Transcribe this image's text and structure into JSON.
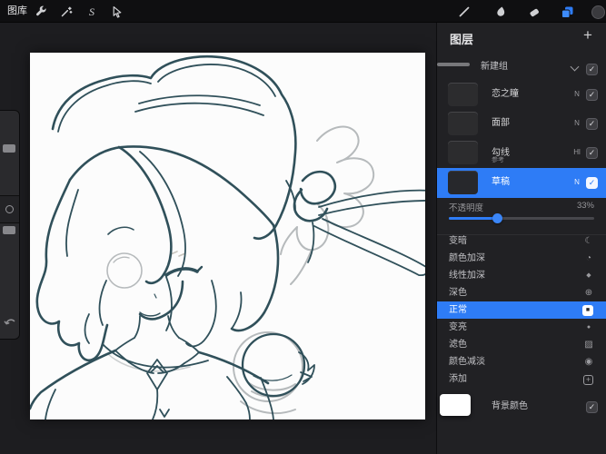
{
  "topbar": {
    "gallery_label": "图库",
    "left_tools": [
      "actions-wrench",
      "adjustments-wand",
      "selection-s",
      "transform-arrow"
    ],
    "selection_glyph": "S",
    "right_tools": [
      "brush",
      "smudge",
      "eraser",
      "layers",
      "color"
    ]
  },
  "layers_panel": {
    "title": "图层",
    "add_label": "+",
    "group": {
      "label": "新建组"
    },
    "layers": [
      {
        "name": "恋之瞳",
        "badge": "N",
        "checked": true,
        "selected": false
      },
      {
        "name": "面部",
        "badge": "N",
        "checked": true,
        "selected": false
      },
      {
        "name": "勾线",
        "sub": "参考",
        "badge": "Hl",
        "checked": true,
        "selected": false
      },
      {
        "name": "草稿",
        "badge": "N",
        "checked": true,
        "selected": true
      }
    ],
    "opacity": {
      "label": "不透明度",
      "value": "33%",
      "percent": 33
    },
    "blend_modes": [
      {
        "label": "变暗",
        "icon": "darken-moon-icon",
        "glyph": "☾",
        "selected": false
      },
      {
        "label": "颜色加深",
        "icon": "color-burn-icon",
        "glyph": "◔",
        "selected": false
      },
      {
        "label": "线性加深",
        "icon": "linear-burn-icon",
        "glyph": "◆",
        "selected": false
      },
      {
        "label": "深色",
        "icon": "darker-color-icon",
        "glyph": "⊕",
        "selected": false
      },
      {
        "label": "正常",
        "icon": "normal-icon",
        "glyph": "■",
        "selected": true
      },
      {
        "label": "变亮",
        "icon": "lighten-icon",
        "glyph": "●",
        "selected": false
      },
      {
        "label": "滤色",
        "icon": "screen-icon",
        "glyph": "▨",
        "selected": false
      },
      {
        "label": "颜色减淡",
        "icon": "color-dodge-icon",
        "glyph": "◉",
        "selected": false
      },
      {
        "label": "添加",
        "icon": "add-icon",
        "glyph": "+",
        "selected": false
      }
    ],
    "background": {
      "label": "背景颜色",
      "checked": true
    }
  },
  "icons": {
    "check": "✓"
  },
  "colors": {
    "accent_blue": "#2e7cf6",
    "topbar_bg": "#0f0f11",
    "panel_bg": "#212124",
    "canvas_surround": "#1d1d20",
    "line_art": "#30505a",
    "sketch_gray": "#b6babc"
  }
}
